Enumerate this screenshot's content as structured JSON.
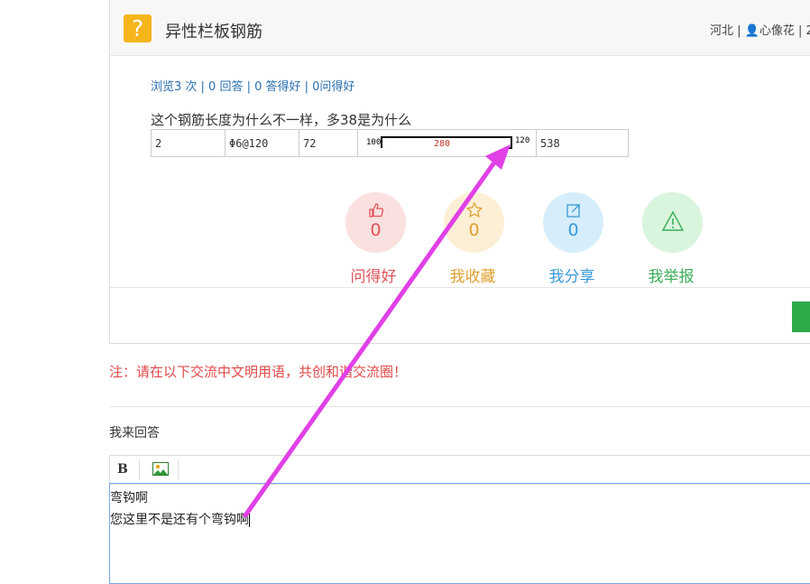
{
  "question": {
    "title": "异性栏板钢筋",
    "meta": "河北 | 👤心像花 | 2",
    "stats": "浏览3 次 | 0 回答 | 0 答得好 | 0问得好",
    "text": "这个钢筋长度为什么不一样，多38是为什么"
  },
  "rebar_table": {
    "count": "2",
    "spec": "Φ6@120",
    "length_code": "72",
    "left_dim": "100",
    "mid_dim": "280",
    "right_dim": "120",
    "total": "538"
  },
  "actions": [
    {
      "label": "问得好",
      "count": "0",
      "icon": "thumbs-up-icon",
      "color": "#e0535a",
      "bg": "#fbe0e0"
    },
    {
      "label": "我收藏",
      "count": "0",
      "icon": "star-icon",
      "color": "#e0a030",
      "bg": "#fdefd6"
    },
    {
      "label": "我分享",
      "count": "0",
      "icon": "share-icon",
      "color": "#3a9ad6",
      "bg": "#d6eefb"
    },
    {
      "label": "我举报",
      "count": "0",
      "icon": "warning-icon",
      "color": "#3cae5a",
      "bg": "#d9f5dd"
    }
  ],
  "notice": "注：请在以下交流中文明用语，共创和谐交流圈！",
  "reply": {
    "label": "我来回答",
    "bold_button": "B",
    "image_button_icon": "image-icon",
    "line1": "弯钩啊",
    "line2": "您这里不是还有个弯钩啊"
  },
  "colors": {
    "arrow": "#e040e6",
    "question_icon": "#f5b51b",
    "link": "#2a6fb0",
    "notice": "#e04848"
  }
}
